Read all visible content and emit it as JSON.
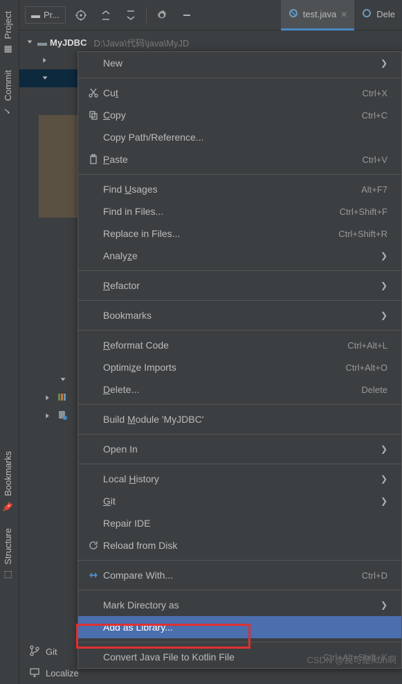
{
  "sidebar_tabs": {
    "project": "Project",
    "commit": "Commit",
    "bookmarks": "Bookmarks",
    "structure": "Structure"
  },
  "toolbar": {
    "project_tab": "Pr..."
  },
  "editor_tabs": {
    "active": "test.java",
    "other": "Dele"
  },
  "tree": {
    "root": "MyJDBC",
    "root_path": "D:\\Java\\代码\\java\\MyJD"
  },
  "bottom": {
    "git": "Git",
    "localize": "Localize"
  },
  "watermark": "CSDN @我可是ikun啊",
  "ctx": {
    "new": "New",
    "cut": {
      "label": "Cut",
      "m": "t",
      "shortcut": "Ctrl+X"
    },
    "copy": {
      "label": "Copy",
      "m": "C",
      "shortcut": "Ctrl+C"
    },
    "copy_path": "Copy Path/Reference...",
    "paste": {
      "label": "Paste",
      "m": "P",
      "shortcut": "Ctrl+V"
    },
    "find_usages": {
      "label": "Find Usages",
      "m": "U",
      "shortcut": "Alt+F7"
    },
    "find_in_files": {
      "label": "Find in Files...",
      "shortcut": "Ctrl+Shift+F"
    },
    "replace_in_files": {
      "label": "Replace in Files...",
      "shortcut": "Ctrl+Shift+R"
    },
    "analyze": {
      "label": "Analyze",
      "m": "z"
    },
    "refactor": {
      "label": "Refactor",
      "m": "R"
    },
    "bookmarks": "Bookmarks",
    "reformat": {
      "label": "Reformat Code",
      "m": "R",
      "shortcut": "Ctrl+Alt+L"
    },
    "optimize": {
      "label": "Optimize Imports",
      "m": "z",
      "shortcut": "Ctrl+Alt+O"
    },
    "delete": {
      "label": "Delete...",
      "m": "D",
      "shortcut": "Delete"
    },
    "build": {
      "label": "Build Module 'MyJDBC'",
      "m": "M"
    },
    "open_in": "Open In",
    "history": {
      "label": "Local History",
      "m": "H"
    },
    "git": {
      "label": "Git",
      "m": "G"
    },
    "repair": "Repair IDE",
    "reload": "Reload from Disk",
    "compare": {
      "label": "Compare With...",
      "shortcut": "Ctrl+D"
    },
    "mark_dir": "Mark Directory as",
    "add_lib": "Add as Library...",
    "convert": {
      "label": "Convert Java File to Kotlin File",
      "shortcut": "Ctrl+Alt+Shift+K"
    }
  }
}
